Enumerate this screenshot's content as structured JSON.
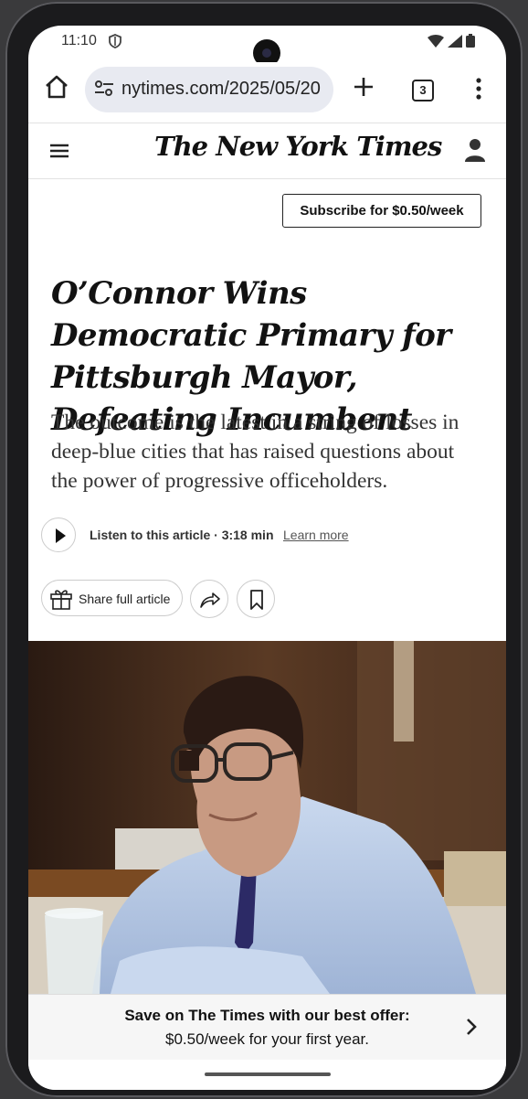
{
  "status_bar": {
    "time": "11:10"
  },
  "browser": {
    "url": "nytimes.com/2025/05/20",
    "tab_count": "3"
  },
  "nyt": {
    "logo": "The New York Times",
    "subscribe_label": "Subscribe for $0.50/week"
  },
  "article": {
    "headline": "O’Connor Wins Democratic Primary for Pittsburgh Mayor, Defeating Incumbent",
    "summary": "The outcome is the latest in a string of losses in deep-blue cities that has raised questions about the power of progressive officeholders.",
    "listen_label": "Listen to this article · 3:18 min",
    "learn_more": "Learn more",
    "share_label": "Share full article"
  },
  "offer": {
    "line1": "Save on The Times with our best offer:",
    "line2": "$0.50/week for your first year."
  },
  "colors": {
    "accent": "#121212",
    "url_pill": "#e8eaf1",
    "banner": "#f6f6f6"
  }
}
